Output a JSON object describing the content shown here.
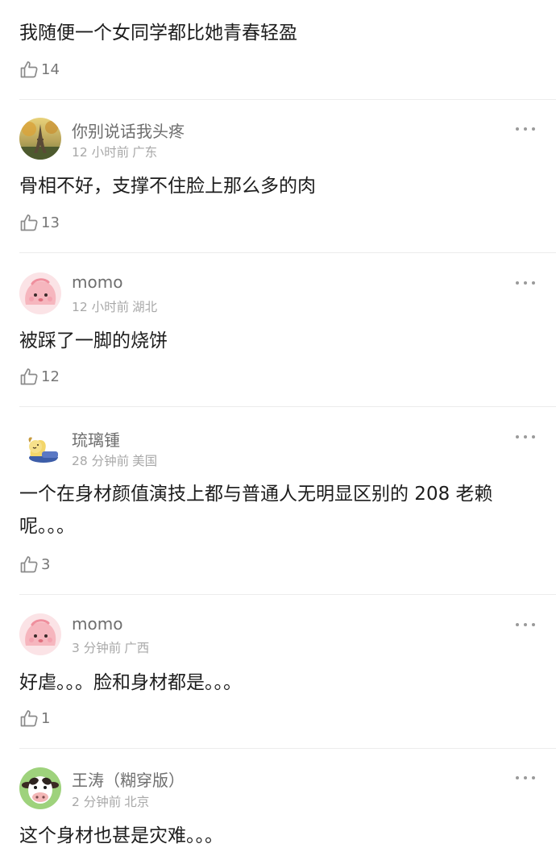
{
  "comments": [
    {
      "text": "我随便一个女同学都比她青春轻盈",
      "likes": "14"
    },
    {
      "username": "你别说话我头疼",
      "time": "12 小时前",
      "location": "广东",
      "text": "骨相不好，支撑不住脸上那么多的肉",
      "likes": "13",
      "avatar_icon": "eiffel-tower-icon"
    },
    {
      "username": "momo",
      "time": "12 小时前",
      "location": "湖北",
      "text": "被踩了一脚的烧饼",
      "likes": "12",
      "avatar_icon": "pink-blob-icon"
    },
    {
      "username": "琉璃锺",
      "time": "28 分钟前",
      "location": "美国",
      "text": "一个在身材颜值演技上都与普通人无明显区别的 208 老赖呢。。。",
      "likes": "3",
      "avatar_icon": "sleeping-dog-icon"
    },
    {
      "username": "momo",
      "time": "3 分钟前",
      "location": "广西",
      "text": "好虐。。。脸和身材都是。。。",
      "likes": "1",
      "avatar_icon": "pink-blob-icon"
    },
    {
      "username": "王涛（糊穿版）",
      "time": "2 分钟前",
      "location": "北京",
      "text": "这个身材也甚是灾难。。。",
      "avatar_icon": "cow-icon"
    }
  ],
  "colors": {
    "username": "#6e6e6e",
    "meta": "#a8a8a8",
    "body_text": "#1d1d1d",
    "divider": "#ececec"
  }
}
